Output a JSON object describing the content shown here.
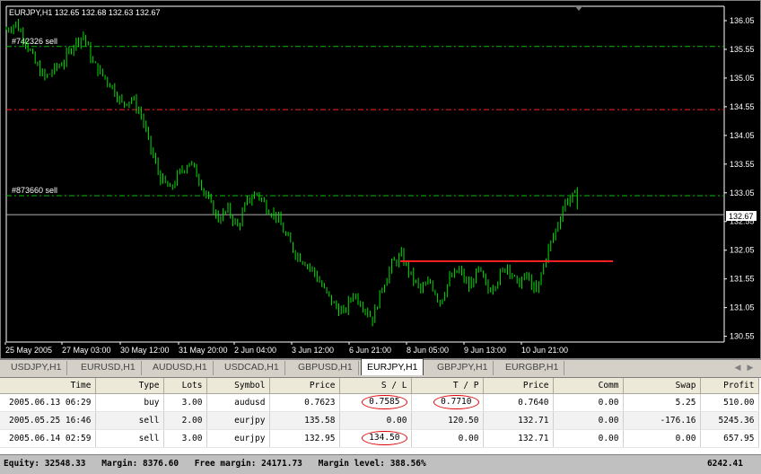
{
  "chart": {
    "header": "EURJPY,H1  132.65 132.68 132.63 132.67",
    "current_price_label": "132.67",
    "price_ticks": [
      "136.05",
      "135.55",
      "135.05",
      "134.55",
      "134.05",
      "133.55",
      "133.05",
      "132.55",
      "132.05",
      "131.55",
      "131.05",
      "130.55"
    ],
    "time_ticks": [
      "25 May 2005",
      "27 May 03:00",
      "30 May 12:00",
      "31 May 20:00",
      "2 Jun 04:00",
      "3 Jun 12:00",
      "6 Jun 21:00",
      "8 Jun 05:00",
      "9 Jun 13:00",
      "10 Jun 21:00"
    ],
    "order_lines": [
      {
        "label": "#742326 sell",
        "price": 135.6,
        "color": "#00c000"
      },
      {
        "label": "#873660 sell",
        "price": 133.0,
        "color": "#00c000"
      }
    ],
    "sl_line_price": 134.5,
    "candle_color": "#00e000",
    "level_color": "#ff2020",
    "price_path": [
      [
        0,
        135.9
      ],
      [
        2,
        136.0
      ],
      [
        4,
        135.7
      ],
      [
        6,
        135.3
      ],
      [
        8,
        135.05
      ],
      [
        10,
        135.2
      ],
      [
        12,
        135.35
      ],
      [
        14,
        135.65
      ],
      [
        16,
        135.8
      ],
      [
        18,
        135.3
      ],
      [
        20,
        135.1
      ],
      [
        22,
        134.9
      ],
      [
        24,
        134.6
      ],
      [
        26,
        134.7
      ],
      [
        28,
        134.4
      ],
      [
        30,
        133.8
      ],
      [
        32,
        133.3
      ],
      [
        34,
        133.1
      ],
      [
        36,
        133.4
      ],
      [
        38,
        133.6
      ],
      [
        40,
        133.3
      ],
      [
        42,
        132.9
      ],
      [
        44,
        132.6
      ],
      [
        46,
        132.75
      ],
      [
        48,
        132.45
      ],
      [
        50,
        132.9
      ],
      [
        52,
        133.05
      ],
      [
        54,
        132.8
      ],
      [
        56,
        132.65
      ],
      [
        58,
        132.3
      ],
      [
        60,
        132.0
      ],
      [
        62,
        131.85
      ],
      [
        64,
        131.65
      ],
      [
        66,
        131.35
      ],
      [
        68,
        131.1
      ],
      [
        70,
        130.95
      ],
      [
        72,
        131.3
      ],
      [
        74,
        131.1
      ],
      [
        76,
        130.85
      ],
      [
        78,
        131.4
      ],
      [
        80,
        131.8
      ],
      [
        82,
        131.95
      ],
      [
        84,
        131.6
      ],
      [
        86,
        131.35
      ],
      [
        88,
        131.5
      ],
      [
        90,
        131.15
      ],
      [
        92,
        131.55
      ],
      [
        94,
        131.7
      ],
      [
        96,
        131.4
      ],
      [
        98,
        131.7
      ],
      [
        100,
        131.35
      ],
      [
        102,
        131.55
      ],
      [
        104,
        131.8
      ],
      [
        106,
        131.45
      ],
      [
        108,
        131.6
      ],
      [
        110,
        131.3
      ],
      [
        112,
        131.95
      ],
      [
        114,
        132.4
      ],
      [
        116,
        132.9
      ],
      [
        118,
        133.0
      ],
      [
        119,
        132.7
      ]
    ]
  },
  "tabs": [
    {
      "label": "USDJPY,H1"
    },
    {
      "label": "EURUSD,H1"
    },
    {
      "label": "AUDUSD,H1"
    },
    {
      "label": "USDCAD,H1"
    },
    {
      "label": "GBPUSD,H1"
    },
    {
      "label": "EURJPY,H1"
    },
    {
      "label": "GBPJPY,H1"
    },
    {
      "label": "EURGBP,H1"
    }
  ],
  "active_tab": "EURJPY,H1",
  "orders": {
    "columns": [
      "Time",
      "Type",
      "Lots",
      "Symbol",
      "Price",
      "S / L",
      "T / P",
      "Price",
      "Comm",
      "Swap",
      "Profit"
    ],
    "rows": [
      [
        "2005.06.13 06:29",
        "buy",
        "3.00",
        "audusd",
        "0.7623",
        "0.7585",
        "0.7710",
        "0.7640",
        "0.00",
        "5.25",
        "510.00"
      ],
      [
        "2005.05.25 16:46",
        "sell",
        "2.00",
        "eurjpy",
        "135.58",
        "0.00",
        "120.50",
        "132.71",
        "0.00",
        "-176.16",
        "5245.36"
      ],
      [
        "2005.06.14 02:59",
        "sell",
        "3.00",
        "eurjpy",
        "132.95",
        "134.50",
        "0.00",
        "132.71",
        "0.00",
        "0.00",
        "657.95"
      ]
    ],
    "circled_cells": [
      [
        0,
        5
      ],
      [
        0,
        6
      ],
      [
        2,
        5
      ]
    ]
  },
  "status": {
    "equity": "Equity: 32548.33",
    "margin": "Margin: 8376.60",
    "free_margin": "Free margin: 24171.73",
    "margin_level": "Margin level: 388.56%",
    "total": "6242.41"
  }
}
